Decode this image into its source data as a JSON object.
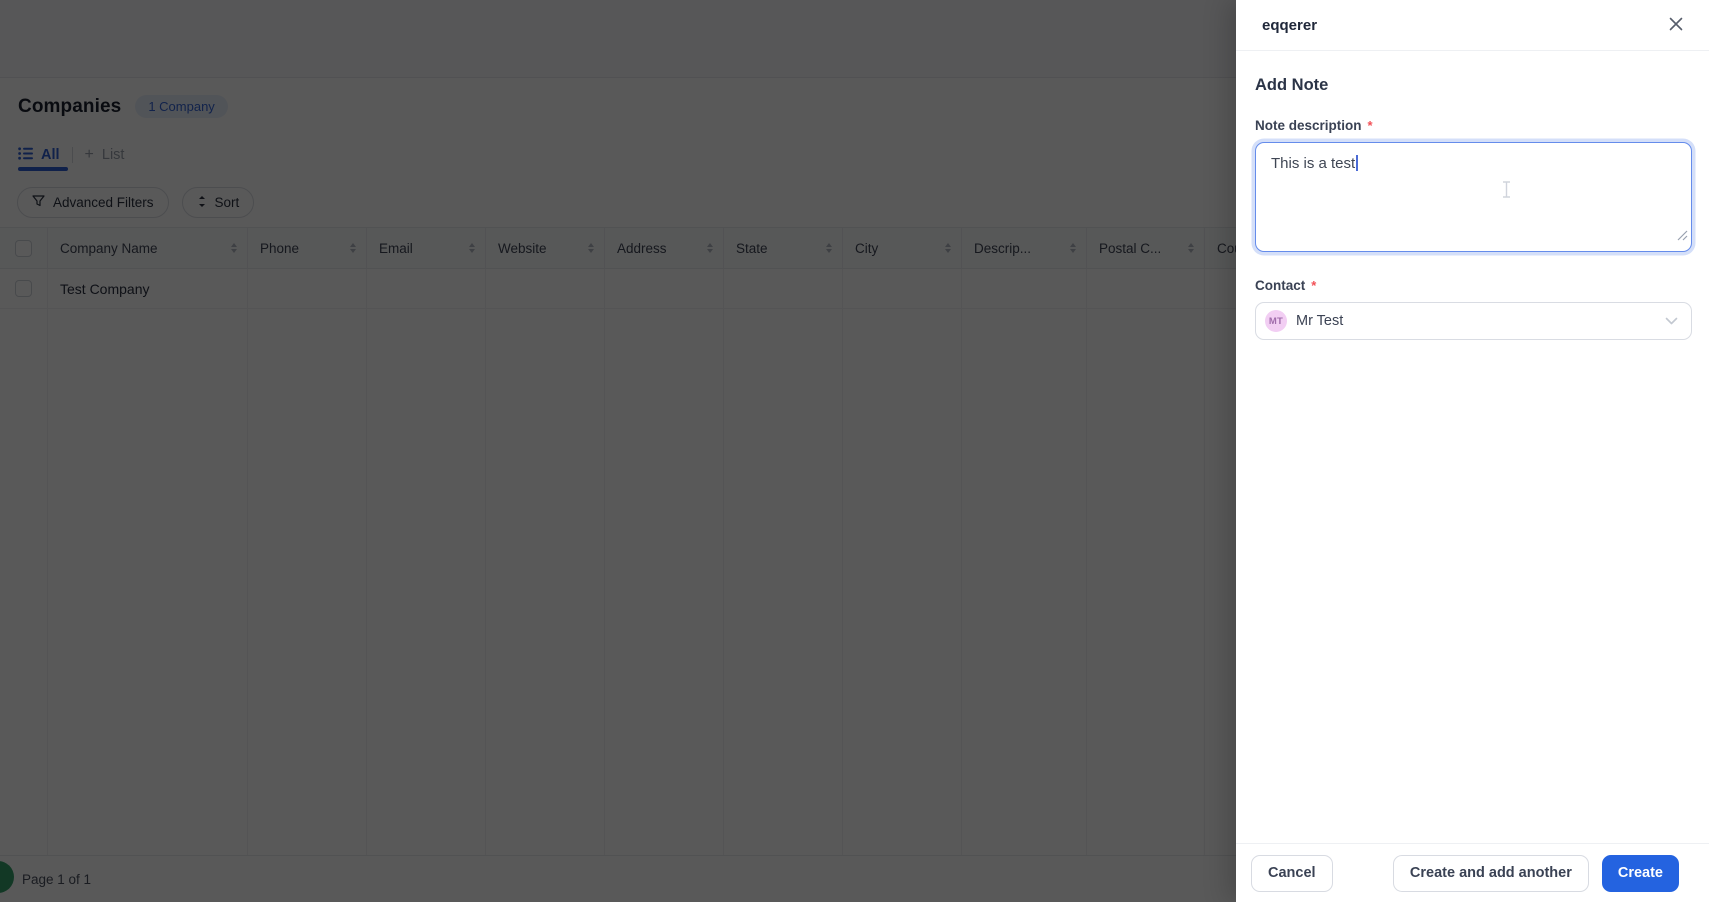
{
  "page": {
    "title": "Companies",
    "count_badge": "1 Company",
    "tabs": {
      "all": "All",
      "add_list": "List"
    },
    "toolbar": {
      "advanced_filters": "Advanced Filters",
      "sort": "Sort"
    },
    "table": {
      "columns": [
        "Company Name",
        "Phone",
        "Email",
        "Website",
        "Address",
        "State",
        "City",
        "Descrip...",
        "Postal C...",
        "Cou"
      ],
      "rows": [
        {
          "company_name": "Test Company"
        }
      ]
    },
    "pagination": "Page 1 of 1"
  },
  "drawer": {
    "title": "eqqerer",
    "heading": "Add Note",
    "fields": {
      "note_description": {
        "label": "Note description",
        "required": "*",
        "value": "This is a test"
      },
      "contact": {
        "label": "Contact",
        "required": "*",
        "value": "Mr Test",
        "avatar_initials": "MT"
      }
    },
    "footer": {
      "cancel": "Cancel",
      "create_add_another": "Create and add another",
      "create": "Create"
    }
  },
  "colors": {
    "primary_blue": "#2463e0",
    "tab_blue": "#2e5fd3",
    "badge_bg": "#e9effc",
    "badge_text": "#3566d6",
    "required_red": "#f25056",
    "avatar_bg": "#f2cef3",
    "avatar_text": "#a06cab",
    "fab_green": "#36a26b",
    "overlay": "rgba(0,0,0,0.65)"
  }
}
